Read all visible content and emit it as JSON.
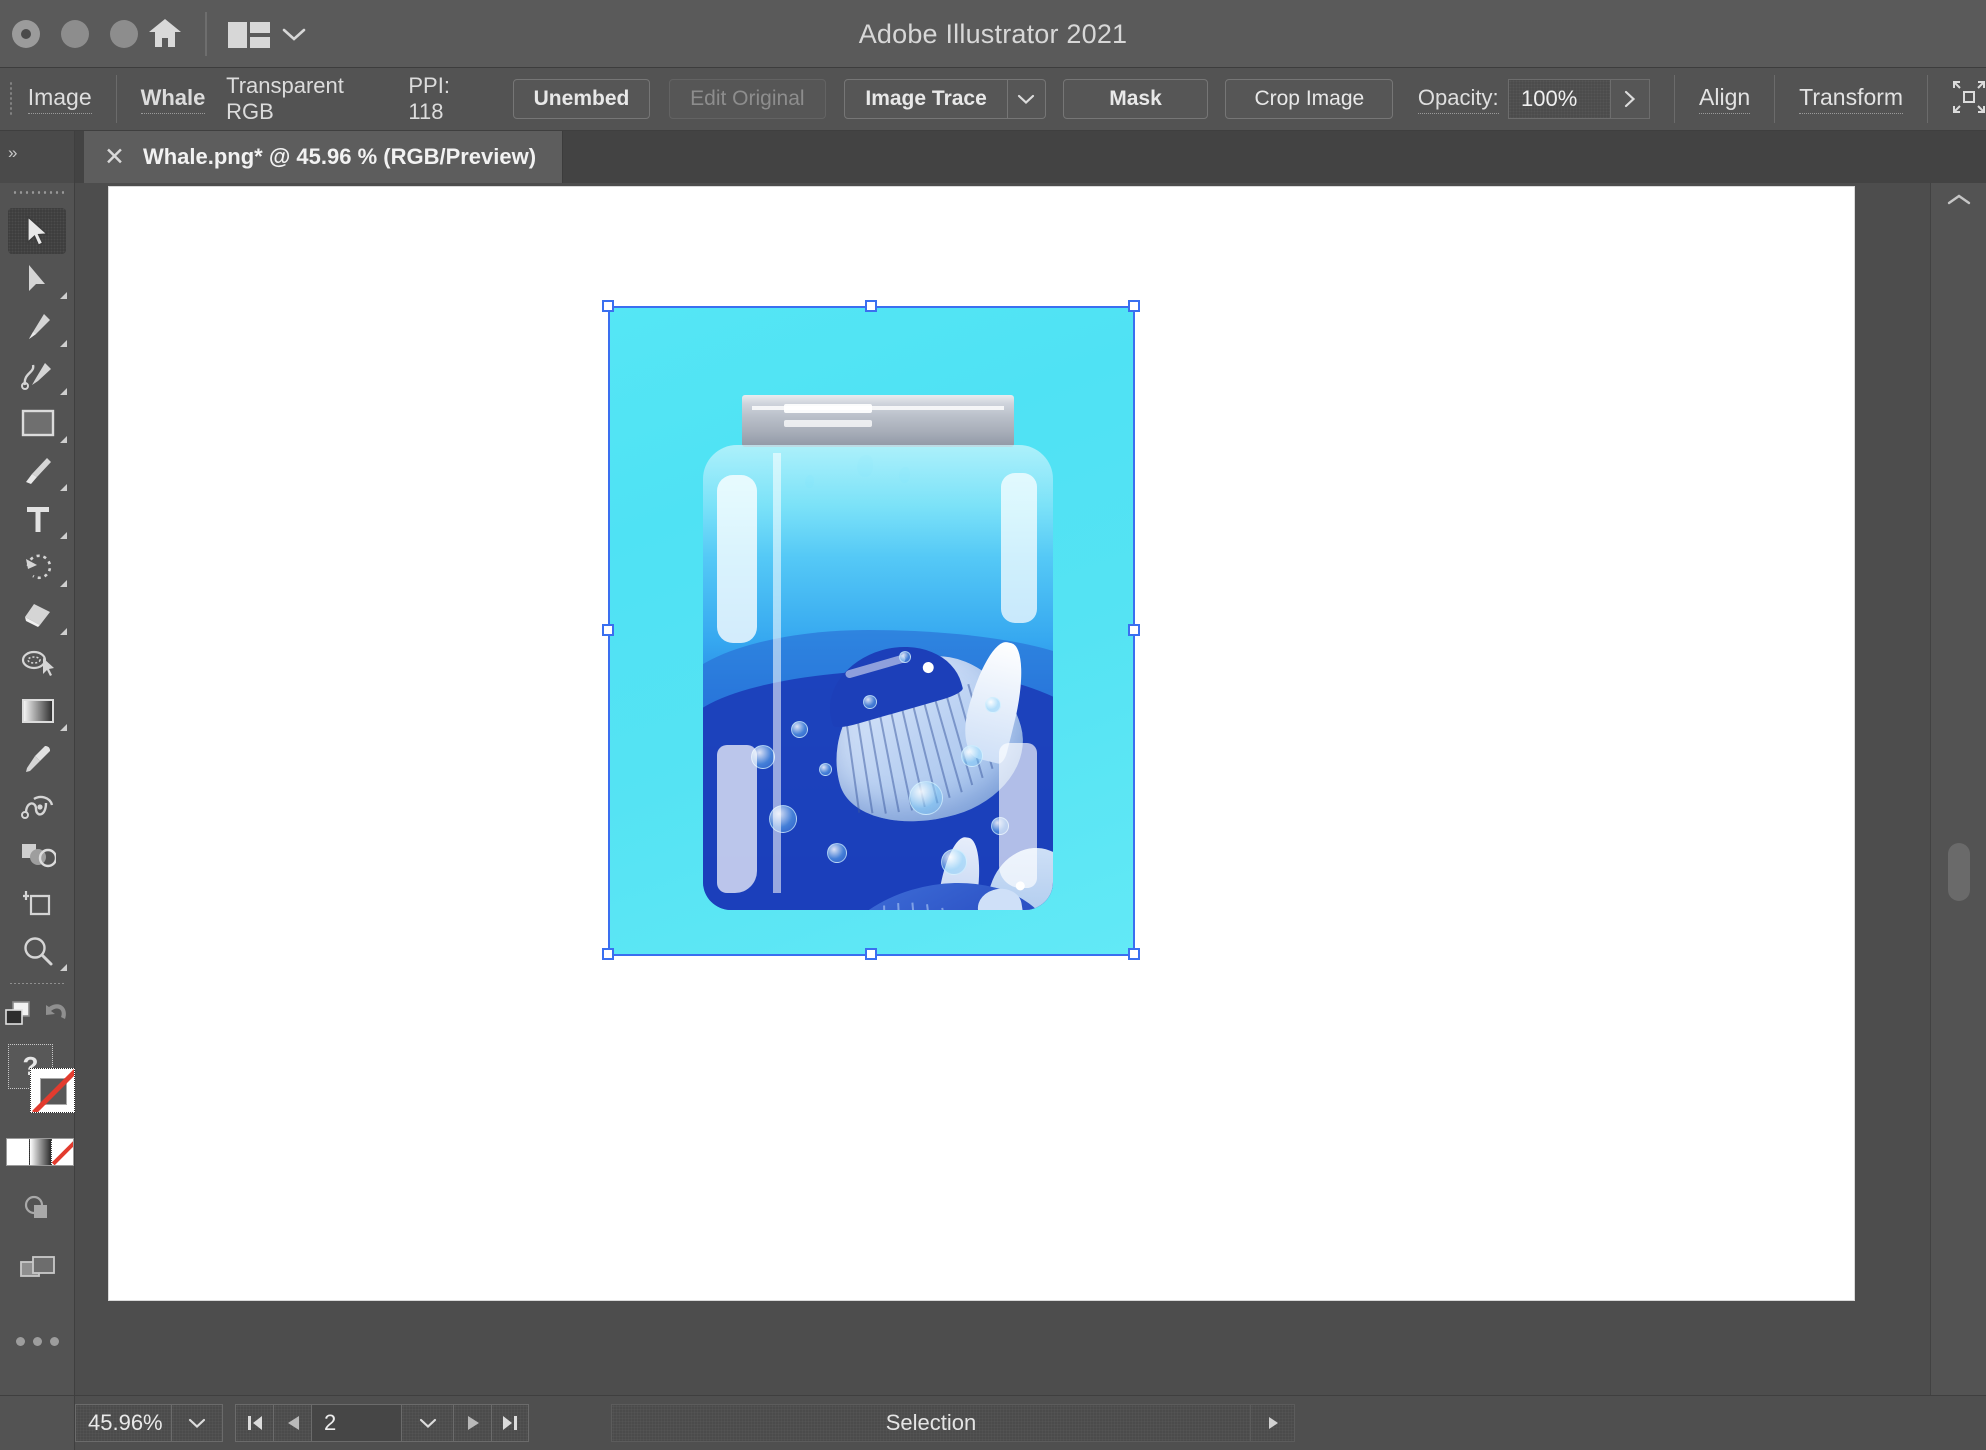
{
  "window": {
    "title": "Adobe Illustrator 2021",
    "traffic_lights": [
      "close",
      "minimize",
      "maximize"
    ],
    "home_icon": "home-icon",
    "layout_icon": "layout-switcher-icon",
    "layout_chevron": "chevron-down-icon"
  },
  "control_bar": {
    "type_label": "Image",
    "name": "Whale",
    "color_mode": "Transparent RGB",
    "ppi": "PPI: 118",
    "unembed_label": "Unembed",
    "edit_original_label": "Edit Original",
    "edit_original_disabled": true,
    "image_trace_label": "Image Trace",
    "image_trace_chevron": "chevron-down-icon",
    "mask_label": "Mask",
    "crop_image_label": "Crop Image",
    "opacity_label": "Opacity:",
    "opacity_value": "100%",
    "opacity_arrow": "chevron-right-icon",
    "align_label": "Align",
    "transform_label": "Transform",
    "collapse_icon": "collapse-panel-icon"
  },
  "tab": {
    "close_icon": "close-icon",
    "title": "Whale.png* @ 45.96 % (RGB/Preview)"
  },
  "toolbar": {
    "expand_icon": "expand-toolbar-icon",
    "tools": [
      {
        "name": "selection-tool",
        "active": true,
        "has_flyout": false
      },
      {
        "name": "direct-selection-tool",
        "active": false,
        "has_flyout": true
      },
      {
        "name": "pen-tool",
        "active": false,
        "has_flyout": true
      },
      {
        "name": "curvature-tool",
        "active": false,
        "has_flyout": false
      },
      {
        "name": "rectangle-tool",
        "active": false,
        "has_flyout": true
      },
      {
        "name": "paintbrush-tool",
        "active": false,
        "has_flyout": true
      },
      {
        "name": "type-tool",
        "active": false,
        "has_flyout": true
      },
      {
        "name": "rotate-tool",
        "active": false,
        "has_flyout": true
      },
      {
        "name": "eraser-tool",
        "active": false,
        "has_flyout": true
      },
      {
        "name": "lasso-tool",
        "active": false,
        "has_flyout": false
      },
      {
        "name": "gradient-tool",
        "active": false,
        "has_flyout": true
      },
      {
        "name": "eyedropper-tool",
        "active": false,
        "has_flyout": false
      },
      {
        "name": "blend-tool",
        "active": false,
        "has_flyout": false
      },
      {
        "name": "shape-builder-tool",
        "active": false,
        "has_flyout": false
      },
      {
        "name": "artboard-tool",
        "active": false,
        "has_flyout": false
      },
      {
        "name": "zoom-tool",
        "active": false,
        "has_flyout": true
      }
    ],
    "arrange_icon": "arrange-documents-icon",
    "undo_icon": "undo-icon",
    "fill_label": "?",
    "stroke_swatch": "none-stroke",
    "swatch_modes": [
      "color-swatch",
      "gradient-swatch",
      "none-swatch"
    ],
    "drawing_mode_icon": "draw-normal-icon",
    "screen_mode_icon": "screen-mode-icon",
    "more_tools_icon": "more-tools-icon"
  },
  "canvas": {
    "artwork_name": "whale-in-jar-illustration",
    "selection_color": "#3a6ff0",
    "background": "#4d4d4d",
    "page_background": "#ffffff",
    "artwork_colors": {
      "sky": "#55e6f5",
      "water_light": "#55c9f6",
      "water_mid": "#2a6fd6",
      "water_deep": "#1b3fbb",
      "whale_dark": "#1c3fb9",
      "whale_light": "#bdd3f3",
      "lid_metal": "#b9bfc9"
    },
    "handles": [
      "top-left",
      "top-center",
      "top-right",
      "middle-left",
      "middle-right",
      "bottom-left",
      "bottom-center",
      "bottom-right"
    ]
  },
  "scrollbars": {
    "vertical_chevron": "chevron-up-icon",
    "horizontal_chevron": "chevron-left-icon"
  },
  "status_bar": {
    "zoom_value": "45.96%",
    "zoom_chevron": "chevron-down-icon",
    "first_artboard_icon": "first-artboard-icon",
    "prev_artboard_icon": "previous-artboard-icon",
    "artboard_number": "2",
    "artboard_chevron": "chevron-down-icon",
    "next_artboard_icon": "next-artboard-icon",
    "last_artboard_icon": "last-artboard-icon",
    "status_text": "Selection",
    "status_arrow": "play-arrow-icon"
  }
}
